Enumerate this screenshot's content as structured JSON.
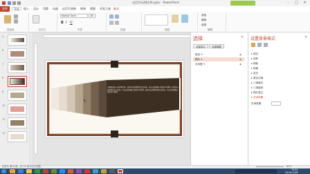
{
  "window": {
    "title": "幻灯片示例文件.pptx - PowerPoint",
    "minimize": "–",
    "maximize": "□",
    "close": "✕",
    "logo_text": "插件"
  },
  "tabs": [
    "文件",
    "开始",
    "插入",
    "设计",
    "切换",
    "动画",
    "幻灯片放映",
    "审阅",
    "视图",
    "开发工具",
    "格式"
  ],
  "ribbon": {
    "groups": [
      "剪贴板",
      "幻灯片",
      "字体",
      "段落",
      "绘图",
      "编辑"
    ],
    "font_name": "Nordic Sans",
    "font_size": "18",
    "find_label": "查找",
    "replace_label": "替换",
    "select_label": "选择"
  },
  "thumbnails": [
    "5",
    "6",
    "7",
    "8",
    "9",
    "10",
    "11",
    "12"
  ],
  "slide": {
    "body_text": "大家好这是一段示例文本。这里可以放置你的正文内容，可以在这里输入你的文字说明。这里可以放置你的正文内容，可以在这里输入你的文字说明，这里可以放置你的正文内容，可以在这里输入你的文字说明。",
    "stripe_colors": [
      "#efe9df",
      "#e4dccf",
      "#d3c7b6",
      "#b8a78f",
      "#95806a",
      "#74604c",
      "#5b4a3a"
    ],
    "frame_color": "#7a3d1f",
    "dark_color": "#3d2f22"
  },
  "selection_pane": {
    "title": "选择",
    "show_all": "全部显示",
    "hide_all": "全部隐藏",
    "items": [
      "矩形 5",
      "图片 4",
      "文本框 3"
    ]
  },
  "format_pane": {
    "title": "设置背景格式",
    "items": [
      "填充",
      "线条",
      "阴影",
      "映像",
      "发光",
      "柔化边缘",
      "三维格式",
      "三维旋转",
      "图片更正",
      "艺术效果"
    ],
    "sub_label": "艺术效果"
  },
  "status": {
    "text": "幻灯片 第 8 张，共 15 张     中文(中国)",
    "zoom": "60%"
  },
  "taskbar": {
    "time": "19:05",
    "date": "2014/11/26"
  },
  "colors": {
    "accent": "#c0442c",
    "taskbar": "#2b4a6d"
  }
}
